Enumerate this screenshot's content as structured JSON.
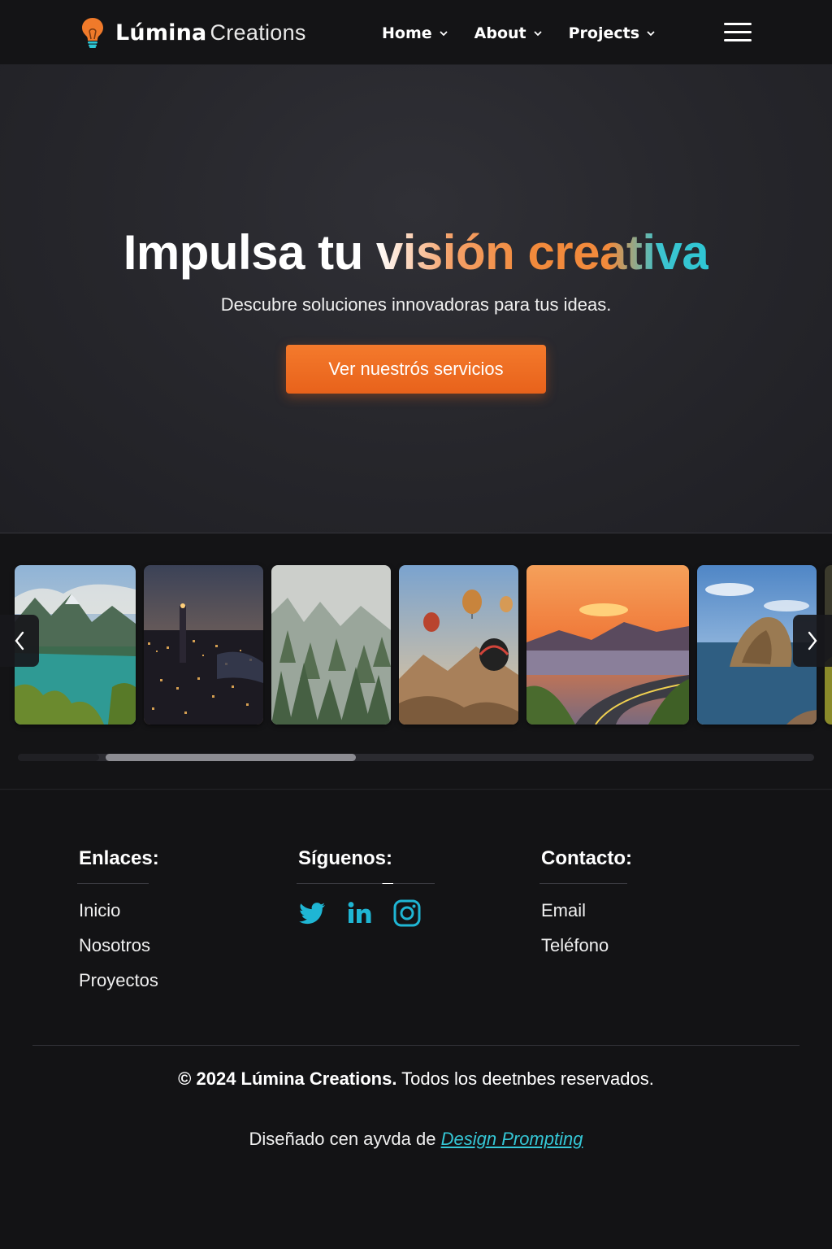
{
  "nav": {
    "brand_strong": "Lúmina",
    "brand_light": "Creations",
    "links": [
      {
        "label": "Home",
        "icon": "chevron-down-icon"
      },
      {
        "label": "About",
        "icon": "chevron-down-icon"
      },
      {
        "label": "Projects",
        "icon": "chevron-down-icon"
      }
    ],
    "menu_icon": "hamburger-menu-icon",
    "logo_icon": "lightbulb-icon"
  },
  "hero": {
    "title_plain": "Impulsa tu ",
    "title_gradient": "visión creativa",
    "subtitle": "Descubre soluciones innovadoras para tus ideas.",
    "cta_label": "Ver nuestrós servicios"
  },
  "gallery": {
    "images": [
      "mountain-lake",
      "city-night",
      "misty-forest",
      "hot-air-balloons",
      "sunset-road",
      "rock-island",
      "partial-image"
    ],
    "prev_icon": "chevron-left-icon",
    "next_icon": "chevron-right-icon",
    "scroll_position": 0.33
  },
  "footer": {
    "links_heading": "Enlaces:",
    "links": [
      "Inicio",
      "Nosotros",
      "Proyectos"
    ],
    "social_heading": "Síguenos:",
    "social_icons": [
      "twitter-icon",
      "linkedin-icon",
      "instagram-icon"
    ],
    "contact_heading": "Contacto:",
    "contact": [
      "Email",
      "Teléfono"
    ],
    "copyright_bold": "© 2024 Lúmina Creations.",
    "copyright_rest": " Todos los deetnbes reservados.",
    "credit_prefix": "Diseñado cen ayvda de ",
    "credit_link": "Design Prompting"
  },
  "colors": {
    "accent_orange": "#F07028",
    "accent_teal": "#35C7D6",
    "background": "#151518"
  }
}
